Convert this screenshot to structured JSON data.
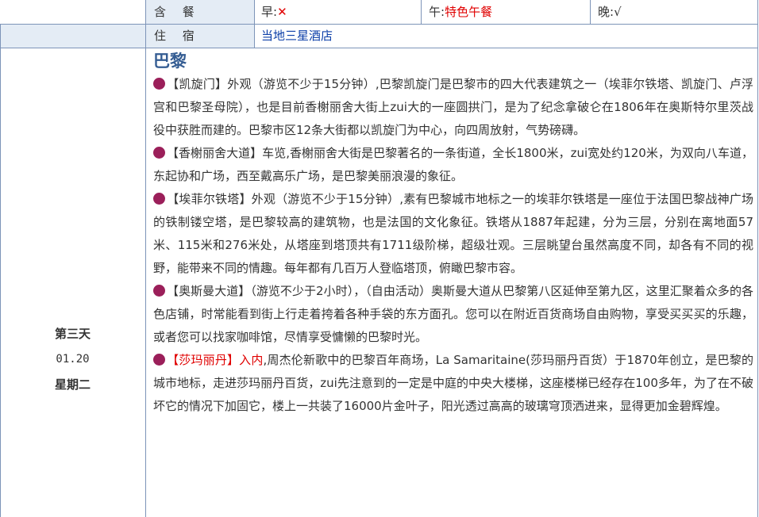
{
  "meals": {
    "label": "含 餐",
    "breakfast_label": "早:",
    "breakfast_value": "✕",
    "lunch_label": "午:",
    "lunch_value": "特色午餐",
    "dinner_label": "晚:",
    "dinner_value": "√"
  },
  "stay": {
    "label": "住 宿",
    "value": "当地三星酒店"
  },
  "day": {
    "title": "第三天",
    "date": "01.20",
    "weekday": "星期二"
  },
  "city": "巴黎",
  "items": [
    {
      "name": "【凯旋门】",
      "text": "外观（游览不少于15分钟）,巴黎凯旋门是巴黎市的四大代表建筑之一（埃菲尔铁塔、凯旋门、卢浮宫和巴黎圣母院），也是目前香榭丽舍大街上zui大的一座圆拱门，是为了纪念拿破仑在1806年在奥斯特尔里茨战役中获胜而建的。巴黎市区12条大街都以凯旋门为中心，向四周放射，气势磅礴。"
    },
    {
      "name": "【香榭丽舍大道】",
      "text": "车览,香榭丽舍大街是巴黎著名的一条街道，全长1800米，zui宽处约120米，为双向八车道，东起协和广场，西至戴高乐广场，是巴黎美丽浪漫的象征。"
    },
    {
      "name": "【埃菲尔铁塔】",
      "text": "外观（游览不少于15分钟）,素有巴黎城市地标之一的埃菲尔铁塔是一座位于法国巴黎战神广场的铁制镂空塔，是巴黎较高的建筑物，也是法国的文化象征。铁塔从1887年起建，分为三层，分别在离地面57米、115米和276米处，从塔座到塔顶共有1711级阶梯，超级壮观。三层眺望台虽然高度不同，却各有不同的视野，能带来不同的情趣。每年都有几百万人登临塔顶，俯瞰巴黎市容。"
    },
    {
      "name": "【奥斯曼大道】",
      "text": "（游览不少于2小时），（自由活动）奥斯曼大道从巴黎第八区延伸至第九区，这里汇聚着众多的各色店铺，时常能看到街上行走着挎着各种手袋的东方面孔。您可以在附近百货商场自由购物，享受买买买的乐趣，或者您可以找家咖啡馆，尽情享受慵懒的巴黎时光。"
    },
    {
      "name": "【莎玛丽丹】",
      "mode": "入内",
      "text": ",周杰伦新歌中的巴黎百年商场，La Samaritaine(莎玛丽丹百货）于1870年创立，是巴黎的城市地标，走进莎玛丽丹百货，zui先注意到的一定是中庭的中央大楼梯，这座楼梯已经存在100多年，为了在不破坏它的情况下加固它，楼上一共装了16000片金叶子，阳光透过高高的玻璃穹顶洒进来，显得更加金碧辉煌。"
    }
  ]
}
